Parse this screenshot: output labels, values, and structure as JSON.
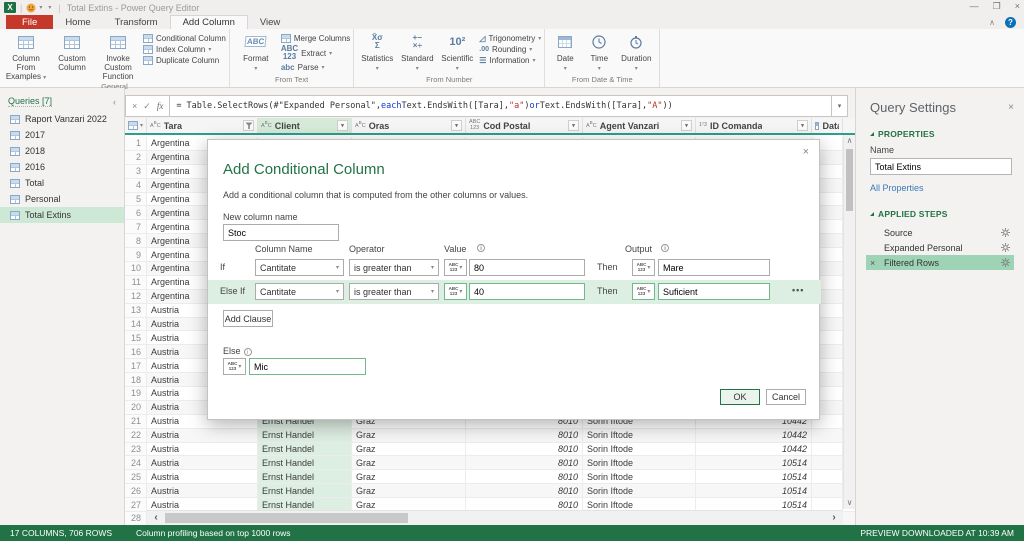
{
  "titlebar": {
    "app_icon": "X",
    "title": "Total Extins - Power Query Editor",
    "minimize": "—",
    "restore": "❐",
    "close": "×",
    "ribbon_collapse": "∧",
    "help": "?"
  },
  "tabs": [
    {
      "label": "File",
      "style": "file"
    },
    {
      "label": "Home",
      "style": "normal"
    },
    {
      "label": "Transform",
      "style": "normal"
    },
    {
      "label": "Add Column",
      "style": "active"
    },
    {
      "label": "View",
      "style": "normal"
    }
  ],
  "ribbon": {
    "groups": [
      {
        "label": "General",
        "large": [
          {
            "label": "Column From Examples",
            "dropdown": true
          },
          {
            "label": "Custom Column",
            "dropdown": false
          },
          {
            "label": "Invoke Custom Function",
            "dropdown": false
          }
        ],
        "small": [
          {
            "label": "Conditional Column",
            "dropdown": false
          },
          {
            "label": "Index Column",
            "dropdown": true
          },
          {
            "label": "Duplicate Column",
            "dropdown": false
          }
        ]
      },
      {
        "label": "From Text",
        "large": [
          {
            "label": "Format",
            "dropdown": true
          }
        ],
        "small": [
          {
            "label": "Merge Columns",
            "dropdown": false
          },
          {
            "label": "Extract",
            "dropdown": true
          },
          {
            "label": "Parse",
            "dropdown": true
          }
        ]
      },
      {
        "label": "From Number",
        "large": [
          {
            "label": "Statistics",
            "dropdown": true
          },
          {
            "label": "Standard",
            "dropdown": true
          },
          {
            "label": "Scientific",
            "dropdown": true
          }
        ],
        "small": [
          {
            "label": "Trigonometry",
            "dropdown": true
          },
          {
            "label": "Rounding",
            "dropdown": true
          },
          {
            "label": "Information",
            "dropdown": true
          }
        ]
      },
      {
        "label": "From Date & Time",
        "large": [
          {
            "label": "Date",
            "dropdown": true
          },
          {
            "label": "Time",
            "dropdown": true
          },
          {
            "label": "Duration",
            "dropdown": true
          }
        ],
        "small": []
      }
    ]
  },
  "formula_bar": {
    "segments": [
      {
        "text": "= Table.SelectRows(#\"Expanded Personal\", ",
        "type": "default"
      },
      {
        "text": "each",
        "type": "keyword"
      },
      {
        "text": " Text.EndsWith([Tara], ",
        "type": "default"
      },
      {
        "text": "\"a\"",
        "type": "string"
      },
      {
        "text": ") ",
        "type": "default"
      },
      {
        "text": "or",
        "type": "keyword"
      },
      {
        "text": " Text.EndsWith([Tara], ",
        "type": "default"
      },
      {
        "text": "\"A\"",
        "type": "string"
      },
      {
        "text": "))",
        "type": "default"
      }
    ]
  },
  "queries_panel": {
    "header": "Queries [7]",
    "collapse_icon": "‹",
    "items": [
      {
        "name": "Raport Vanzari 2022",
        "selected": false
      },
      {
        "name": "2017",
        "selected": false
      },
      {
        "name": "2018",
        "selected": false
      },
      {
        "name": "2016",
        "selected": false
      },
      {
        "name": "Total",
        "selected": false
      },
      {
        "name": "Personal",
        "selected": false
      },
      {
        "name": "Total Extins",
        "selected": true
      }
    ]
  },
  "grid": {
    "columns": [
      {
        "name": "Tara",
        "type": "text",
        "filtered": true,
        "selected": false
      },
      {
        "name": "Client",
        "type": "text",
        "filtered": false,
        "selected": true
      },
      {
        "name": "Oras",
        "type": "text",
        "filtered": false,
        "selected": false
      },
      {
        "name": "Cod Postal",
        "type": "any",
        "filtered": false,
        "selected": false
      },
      {
        "name": "Agent Vanzari",
        "type": "text",
        "filtered": false,
        "selected": false
      },
      {
        "name": "ID Comanda",
        "type": "number",
        "filtered": false,
        "selected": false
      },
      {
        "name": "Data Coma",
        "type": "date",
        "filtered": false,
        "selected": false
      }
    ],
    "rows": [
      {
        "n": "1",
        "tara": "Argentina",
        "client": "",
        "oras": "",
        "cod": "",
        "agent": "",
        "id": ""
      },
      {
        "n": "2",
        "tara": "Argentina",
        "client": "",
        "oras": "",
        "cod": "",
        "agent": "",
        "id": ""
      },
      {
        "n": "3",
        "tara": "Argentina",
        "client": "",
        "oras": "",
        "cod": "",
        "agent": "",
        "id": ""
      },
      {
        "n": "4",
        "tara": "Argentina",
        "client": "",
        "oras": "",
        "cod": "",
        "agent": "",
        "id": ""
      },
      {
        "n": "5",
        "tara": "Argentina",
        "client": "",
        "oras": "",
        "cod": "",
        "agent": "",
        "id": ""
      },
      {
        "n": "6",
        "tara": "Argentina",
        "client": "",
        "oras": "",
        "cod": "",
        "agent": "",
        "id": ""
      },
      {
        "n": "7",
        "tara": "Argentina",
        "client": "",
        "oras": "",
        "cod": "",
        "agent": "",
        "id": ""
      },
      {
        "n": "8",
        "tara": "Argentina",
        "client": "",
        "oras": "",
        "cod": "",
        "agent": "",
        "id": ""
      },
      {
        "n": "9",
        "tara": "Argentina",
        "client": "",
        "oras": "",
        "cod": "",
        "agent": "",
        "id": ""
      },
      {
        "n": "10",
        "tara": "Argentina",
        "client": "",
        "oras": "",
        "cod": "",
        "agent": "",
        "id": ""
      },
      {
        "n": "11",
        "tara": "Argentina",
        "client": "",
        "oras": "",
        "cod": "",
        "agent": "",
        "id": ""
      },
      {
        "n": "12",
        "tara": "Argentina",
        "client": "",
        "oras": "",
        "cod": "",
        "agent": "",
        "id": ""
      },
      {
        "n": "13",
        "tara": "Austria",
        "client": "",
        "oras": "",
        "cod": "",
        "agent": "",
        "id": ""
      },
      {
        "n": "14",
        "tara": "Austria",
        "client": "",
        "oras": "",
        "cod": "",
        "agent": "",
        "id": ""
      },
      {
        "n": "15",
        "tara": "Austria",
        "client": "",
        "oras": "",
        "cod": "",
        "agent": "",
        "id": ""
      },
      {
        "n": "16",
        "tara": "Austria",
        "client": "",
        "oras": "",
        "cod": "",
        "agent": "",
        "id": ""
      },
      {
        "n": "17",
        "tara": "Austria",
        "client": "",
        "oras": "",
        "cod": "",
        "agent": "",
        "id": ""
      },
      {
        "n": "18",
        "tara": "Austria",
        "client": "",
        "oras": "",
        "cod": "",
        "agent": "",
        "id": ""
      },
      {
        "n": "19",
        "tara": "Austria",
        "client": "",
        "oras": "",
        "cod": "",
        "agent": "",
        "id": ""
      },
      {
        "n": "20",
        "tara": "Austria",
        "client": "",
        "oras": "",
        "cod": "",
        "agent": "",
        "id": ""
      },
      {
        "n": "21",
        "tara": "Austria",
        "client": "Ernst Handel",
        "oras": "Graz",
        "cod": "8010",
        "agent": "Sorin Iftode",
        "id": "10442"
      },
      {
        "n": "22",
        "tara": "Austria",
        "client": "Ernst Handel",
        "oras": "Graz",
        "cod": "8010",
        "agent": "Sorin Iftode",
        "id": "10442"
      },
      {
        "n": "23",
        "tara": "Austria",
        "client": "Ernst Handel",
        "oras": "Graz",
        "cod": "8010",
        "agent": "Sorin Iftode",
        "id": "10442"
      },
      {
        "n": "24",
        "tara": "Austria",
        "client": "Ernst Handel",
        "oras": "Graz",
        "cod": "8010",
        "agent": "Sorin Iftode",
        "id": "10514"
      },
      {
        "n": "25",
        "tara": "Austria",
        "client": "Ernst Handel",
        "oras": "Graz",
        "cod": "8010",
        "agent": "Sorin Iftode",
        "id": "10514"
      },
      {
        "n": "26",
        "tara": "Austria",
        "client": "Ernst Handel",
        "oras": "Graz",
        "cod": "8010",
        "agent": "Sorin Iftode",
        "id": "10514"
      },
      {
        "n": "27",
        "tara": "Austria",
        "client": "Ernst Handel",
        "oras": "Graz",
        "cod": "8010",
        "agent": "Sorin Iftode",
        "id": "10514"
      },
      {
        "n": "28",
        "tara": "",
        "client": "",
        "oras": "",
        "cod": "",
        "agent": "",
        "id": ""
      }
    ]
  },
  "dialog": {
    "title": "Add Conditional Column",
    "description": "Add a conditional column that is computed from the other columns or values.",
    "close": "×",
    "new_column_label": "New column name",
    "new_column_value": "Stoc",
    "headers": {
      "column_name": "Column Name",
      "operator": "Operator",
      "value": "Value",
      "output": "Output"
    },
    "rows": [
      {
        "kind": "If",
        "column": "Cantitate",
        "operator": "is greater than",
        "value": "80",
        "then": "Then",
        "output": "Mare",
        "highlight": false,
        "more": ""
      },
      {
        "kind": "Else If",
        "column": "Cantitate",
        "operator": "is greater than",
        "value": "40",
        "then": "Then",
        "output": "Suficient",
        "highlight": true,
        "more": "•••"
      }
    ],
    "type_badge": "ABC|123",
    "add_clause_label": "Add Clause",
    "else_label": "Else",
    "else_value": "Mic",
    "ok_label": "OK",
    "cancel_label": "Cancel"
  },
  "query_settings": {
    "title": "Query Settings",
    "close": "×",
    "properties_header": "PROPERTIES",
    "name_label": "Name",
    "name_value": "Total Extins",
    "all_properties_label": "All Properties",
    "applied_steps_header": "APPLIED STEPS",
    "steps": [
      {
        "name": "Source",
        "gear": true,
        "selected": false,
        "deletable": false
      },
      {
        "name": "Expanded Personal",
        "gear": true,
        "selected": false,
        "deletable": false
      },
      {
        "name": "Filtered Rows",
        "gear": true,
        "selected": true,
        "deletable": true
      }
    ]
  },
  "status_bar": {
    "left": "17 COLUMNS, 706 ROWS",
    "middle": "Column profiling based on top 1000 rows",
    "right": "PREVIEW DOWNLOADED AT 10:39 AM"
  },
  "colors": {
    "accent_green": "#217346",
    "header_teal": "#2aa08b",
    "selection_green": "#cde8d4",
    "step_selected": "#9fd3b6",
    "file_tab_red": "#c5392b"
  }
}
